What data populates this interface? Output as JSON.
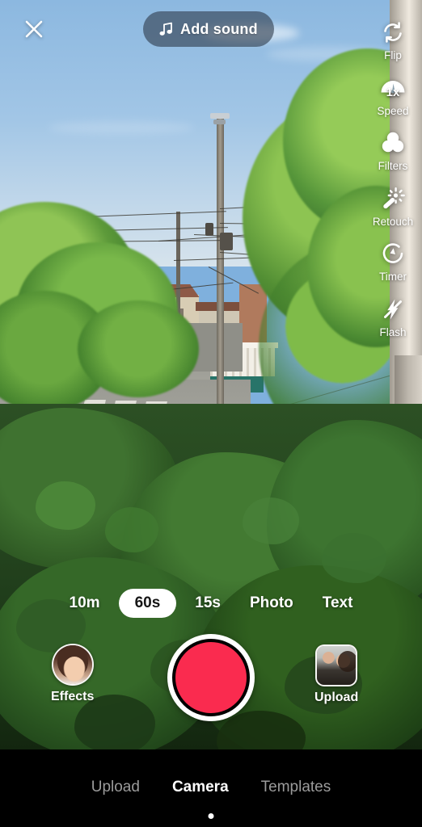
{
  "app": {
    "screen_name": "Camera",
    "accent_record_color": "#fa2b4f",
    "nav_background_color": "#000000",
    "pill_background_color": "#303e4e"
  },
  "topbar": {
    "close_icon": "close-icon",
    "add_sound": {
      "label": "Add sound",
      "icon": "music-note-icon"
    }
  },
  "sidebar": {
    "items": [
      {
        "label": "Flip",
        "icon": "flip-camera-icon"
      },
      {
        "label": "Speed",
        "icon": "speedometer-icon",
        "value": "1x"
      },
      {
        "label": "Filters",
        "icon": "filters-circles-icon"
      },
      {
        "label": "Retouch",
        "icon": "magic-wand-icon"
      },
      {
        "label": "Timer",
        "icon": "timer-clock-icon"
      },
      {
        "label": "Flash",
        "icon": "flash-off-icon"
      }
    ]
  },
  "mode_bar": {
    "selected": "60s",
    "modes": [
      {
        "label": "10m",
        "selected": false
      },
      {
        "label": "60s",
        "selected": true
      },
      {
        "label": "15s",
        "selected": false
      },
      {
        "label": "Photo",
        "selected": false
      },
      {
        "label": "Text",
        "selected": false
      }
    ]
  },
  "shutter_row": {
    "record_button_name": "record-button",
    "effects": {
      "label": "Effects",
      "thumbnail": "effects-face-thumbnail"
    },
    "upload": {
      "label": "Upload",
      "thumbnail": "gallery-photo-thumbnail"
    }
  },
  "bottom_nav": {
    "items": [
      {
        "label": "Upload",
        "active": false
      },
      {
        "label": "Camera",
        "active": true
      },
      {
        "label": "Templates",
        "active": false
      }
    ]
  }
}
